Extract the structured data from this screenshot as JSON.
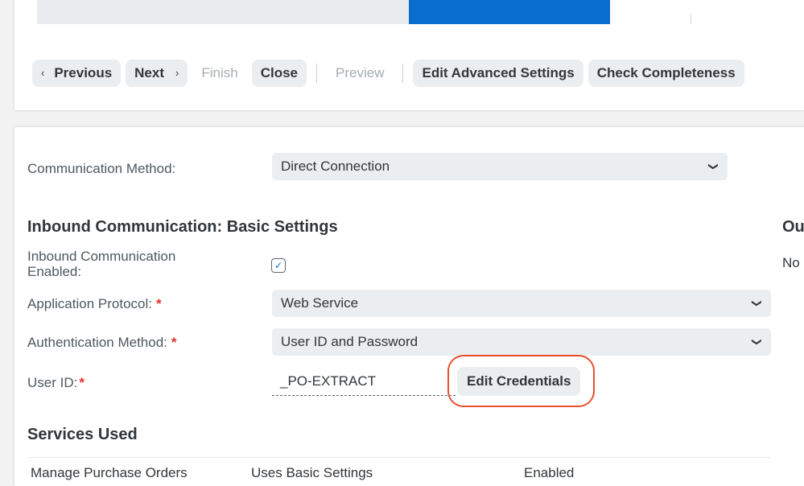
{
  "toolbar": {
    "previous_label": "Previous",
    "previous_icon": "‹",
    "next_label": "Next",
    "next_icon": "›",
    "finish_label": "Finish",
    "close_label": "Close",
    "preview_label": "Preview",
    "edit_advanced_label": "Edit Advanced Settings",
    "check_completeness_label": "Check Completeness"
  },
  "form": {
    "communication_method": {
      "label": "Communication Method:",
      "value": "Direct Connection"
    },
    "inbound_section_title": "Inbound Communication: Basic Settings",
    "outbound_section_title": "Outbound Communication",
    "outbound_value": "No",
    "inbound_enabled": {
      "label_line1": "Inbound Communication",
      "label_line2": "Enabled:",
      "checked": true
    },
    "application_protocol": {
      "label": "Application Protocol:",
      "value": "Web Service"
    },
    "authentication_method": {
      "label": "Authentication Method:",
      "value": "User ID and Password"
    },
    "user_id": {
      "label": "User ID:",
      "value": "_PO-EXTRACT",
      "edit_button_label": "Edit Credentials"
    },
    "required_marker": "*",
    "services_title": "Services Used",
    "services": [
      {
        "name": "Manage Purchase Orders",
        "settings": "Uses Basic Settings",
        "status": "Enabled"
      }
    ]
  },
  "colors": {
    "accent": "#0a6ed1",
    "required": "#e5332b",
    "highlight": "#e8502f"
  }
}
